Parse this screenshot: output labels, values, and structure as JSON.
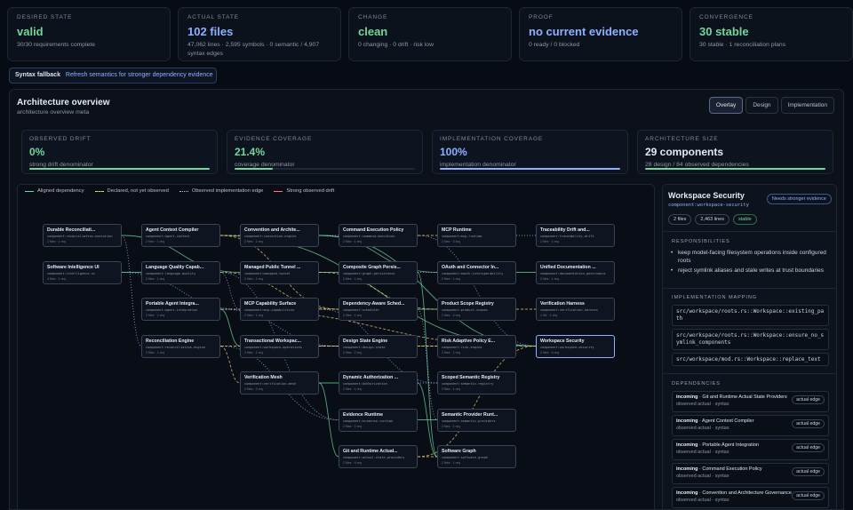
{
  "summary": [
    {
      "label": "DESIRED STATE",
      "value": "valid",
      "sub": "30/30 requirements complete",
      "tone": "green"
    },
    {
      "label": "ACTUAL STATE",
      "value": "102 files",
      "sub": "47,062 lines · 2,595 symbols · 0 semantic / 4,907 syntax edges",
      "tone": "blue"
    },
    {
      "label": "CHANGE",
      "value": "clean",
      "sub": "0 changing · 0 drift · risk low",
      "tone": "green"
    },
    {
      "label": "PROOF",
      "value": "no current evidence",
      "sub": "0 ready / 0 blocked",
      "tone": "blue"
    },
    {
      "label": "CONVERGENCE",
      "value": "30 stable",
      "sub": "30 stable · 1 reconciliation plans",
      "tone": "green"
    }
  ],
  "banner": {
    "title": "Syntax fallback",
    "link": "Refresh semantics for stronger dependency evidence"
  },
  "architecture": {
    "title": "Architecture overview",
    "subtitle": "architecture overview meta",
    "tabs": [
      "Overlay",
      "Design",
      "Implementation"
    ],
    "active_tab": "Overlay",
    "metrics": [
      {
        "label": "OBSERVED DRIFT",
        "value": "0%",
        "sub": "strong drift denominator",
        "tone": "green",
        "fill": 1.0,
        "color": "#74d69a"
      },
      {
        "label": "EVIDENCE COVERAGE",
        "value": "21.4%",
        "sub": "coverage denominator",
        "tone": "green",
        "fill": 0.214,
        "color": "#74d69a"
      },
      {
        "label": "IMPLEMENTATION COVERAGE",
        "value": "100%",
        "sub": "implementation denominator",
        "tone": "blue",
        "fill": 1.0,
        "color": "#8db1ff"
      },
      {
        "label": "ARCHITECTURE SIZE",
        "value": "29 components",
        "sub": "28 design / 84 observed dependencies",
        "tone": "white",
        "fill": 1.0,
        "color": "#74d69a"
      }
    ]
  },
  "legend": [
    {
      "label": "Aligned dependency",
      "color": "#74d69a",
      "style": "solid"
    },
    {
      "label": "Declared, not yet observed",
      "color": "#f0d27a",
      "style": "dashed"
    },
    {
      "label": "Observed implementation edge",
      "color": "#a9c4ff",
      "style": "dotted"
    },
    {
      "label": "Strong observed drift",
      "color": "#ff7a7a",
      "style": "solid"
    }
  ],
  "nodes": [
    {
      "title": "Durable Reconciliati...",
      "id": "component:reconciliation-execution",
      "meta": "2 files · 1 req"
    },
    {
      "title": "Software Intelligence UI",
      "id": "component:intelligence-ui",
      "meta": "4 files · 1 req"
    },
    {
      "title": "Agent Context Compiler",
      "id": "component:agent-context",
      "meta": "2 files · 1 req"
    },
    {
      "title": "Language Quality Capab...",
      "id": "component:language-quality",
      "meta": "2 files · 1 req"
    },
    {
      "title": "Portable Agent Integra...",
      "id": "component:agent-integration",
      "meta": "2 files · 1 req"
    },
    {
      "title": "Reconciliation Engine",
      "id": "component:reconciliation-engine",
      "meta": "2 files · 1 req"
    },
    {
      "title": "Convention and Archite...",
      "id": "component:convention-engine",
      "meta": "2 files · 1 req"
    },
    {
      "title": "Managed Public Tunnel ...",
      "id": "component:managed-tunnel",
      "meta": "2 files · 1 req"
    },
    {
      "title": "MCP Capability Surface",
      "id": "component:mcp-capabilities",
      "meta": "2 files · 1 req"
    },
    {
      "title": "Transactional Workspac...",
      "id": "component:workspace-operations",
      "meta": "2 files · 1 req"
    },
    {
      "title": "Verification Mesh",
      "id": "component:verification-mesh",
      "meta": "2 files · 2 req"
    },
    {
      "title": "Command Execution Policy",
      "id": "component:command-execution",
      "meta": "2 files · 1 req"
    },
    {
      "title": "Composite Graph Persis...",
      "id": "component:graph-persistence",
      "meta": "2 files · 1 req"
    },
    {
      "title": "Dependency-Aware Sched...",
      "id": "component:scheduler",
      "meta": "2 files · 1 req"
    },
    {
      "title": "Design State Engine",
      "id": "component:design-state",
      "meta": "2 files · 2 req"
    },
    {
      "title": "Dynamic Authorization ...",
      "id": "component:authorization",
      "meta": "2 files · 1 req"
    },
    {
      "title": "Evidence Runtime",
      "id": "component:evidence-runtime",
      "meta": "2 files · 2 req"
    },
    {
      "title": "Git and Runtime Actual...",
      "id": "component:actual-state-providers",
      "meta": "2 files · 4 req"
    },
    {
      "title": "MCP Runtime",
      "id": "component:mcp-runtime",
      "meta": "2 files · 3 req"
    },
    {
      "title": "OAuth and Connector In...",
      "id": "component:oauth-interoperability",
      "meta": "2 files · 1 req"
    },
    {
      "title": "Product Scope Registry",
      "id": "component:product-scopes",
      "meta": "2 files · 4 req"
    },
    {
      "title": "Risk Adaptive Policy E...",
      "id": "component:risk-engine",
      "meta": "2 files · 1 req"
    },
    {
      "title": "Scoped Semantic Registry",
      "id": "component:semantic-registry",
      "meta": "2 files · 1 req"
    },
    {
      "title": "Semantic Provider Runt...",
      "id": "component:semantic-providers",
      "meta": "2 files · 1 req"
    },
    {
      "title": "Software Graph",
      "id": "component:software-graph",
      "meta": "2 files · 1 req"
    },
    {
      "title": "Traceability Drift and...",
      "id": "component:traceability-drift",
      "meta": "2 files · 1 req"
    },
    {
      "title": "Unified Documentation ...",
      "id": "component:documentation-governance",
      "meta": "2 files · 1 req"
    },
    {
      "title": "Verification Harness",
      "id": "component:verification-harness",
      "meta": "1 file · 1 req"
    },
    {
      "title": "Workspace Security",
      "id": "component:workspace-security",
      "meta": "2 files · 4 req"
    }
  ],
  "detail": {
    "title": "Workspace Security",
    "id": "component:workspace-security",
    "badge": "Needs stronger evidence",
    "chips": [
      "2 files",
      "2,463 lines",
      "stable"
    ],
    "resp_label": "RESPONSIBILITIES",
    "responsibilities": [
      "keep model-facing filesystem operations inside configured roots",
      "reject symlink aliases and stale writes at trust boundaries"
    ],
    "impl_label": "IMPLEMENTATION MAPPING",
    "mappings": [
      "src/workspace/roots.rs::Workspace::existing_path",
      "src/workspace/roots.rs::Workspace::ensure_no_symlink_components",
      "src/workspace/mod.rs::Workspace::replace_text"
    ],
    "deps_label": "DEPENDENCIES",
    "dependencies": [
      {
        "dir": "incoming",
        "name": "Git and Runtime Actual State Providers",
        "meta": "observed actual · syntax",
        "tag": "actual edge"
      },
      {
        "dir": "incoming",
        "name": "Agent Context Compiler",
        "meta": "observed actual · syntax",
        "tag": "actual edge"
      },
      {
        "dir": "incoming",
        "name": "Portable Agent Integration",
        "meta": "observed actual · syntax",
        "tag": "actual edge"
      },
      {
        "dir": "incoming",
        "name": "Command Execution Policy",
        "meta": "observed actual · syntax",
        "tag": "actual edge"
      },
      {
        "dir": "incoming",
        "name": "Convention and Architecture Governance",
        "meta": "observed actual · syntax",
        "tag": "actual edge"
      }
    ]
  }
}
